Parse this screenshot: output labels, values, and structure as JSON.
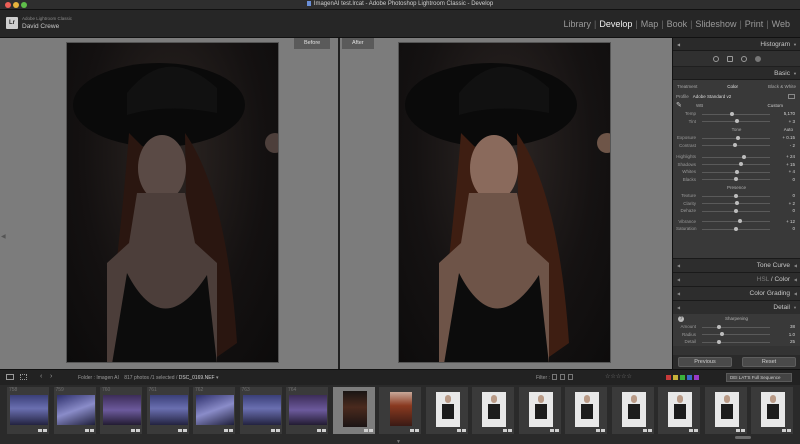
{
  "window": {
    "title": "ImagenAI test.lrcat - Adobe Photoshop Lightroom Classic - Develop"
  },
  "identity": {
    "logo": "Lr",
    "product": "Adobe Lightroom Classic",
    "user": "David Crewe"
  },
  "modules": [
    {
      "label": "Library",
      "active": false
    },
    {
      "label": "Develop",
      "active": true
    },
    {
      "label": "Map",
      "active": false
    },
    {
      "label": "Book",
      "active": false
    },
    {
      "label": "Slideshow",
      "active": false
    },
    {
      "label": "Print",
      "active": false
    },
    {
      "label": "Web",
      "active": false
    }
  ],
  "view": {
    "before_label": "Before",
    "after_label": "After"
  },
  "panel": {
    "histogram": "Histogram",
    "basic": "Basic",
    "treatment": {
      "label": "Treatment",
      "color": "Color",
      "bw": "Black & White"
    },
    "profile": {
      "label": "Profile",
      "value": "Adobe Standard v2"
    },
    "wb": {
      "label": "WB",
      "value": "Custom"
    },
    "temp": {
      "label": "Temp",
      "value": "5,170",
      "level": 0.44
    },
    "tint": {
      "label": "Tint",
      "value": "+ 3",
      "level": 0.52
    },
    "tone_label": "Tone",
    "auto_label": "Auto",
    "exposure": {
      "label": "Exposure",
      "value": "+ 0.15",
      "level": 0.53
    },
    "contrast": {
      "label": "Contrast",
      "value": "- 2",
      "level": 0.49
    },
    "highlights": {
      "label": "Highlights",
      "value": "+ 24",
      "level": 0.62
    },
    "shadows": {
      "label": "Shadows",
      "value": "+ 15",
      "level": 0.57
    },
    "whites": {
      "label": "Whites",
      "value": "+ 4",
      "level": 0.52
    },
    "blacks": {
      "label": "Blacks",
      "value": "0",
      "level": 0.5
    },
    "presence_label": "Presence",
    "texture": {
      "label": "Texture",
      "value": "0",
      "level": 0.5
    },
    "clarity": {
      "label": "Clarity",
      "value": "+ 2",
      "level": 0.51
    },
    "dehaze": {
      "label": "Dehaze",
      "value": "0",
      "level": 0.5
    },
    "vibrance": {
      "label": "Vibrance",
      "value": "+ 12",
      "level": 0.56
    },
    "saturation": {
      "label": "Saturation",
      "value": "0",
      "level": 0.5
    },
    "tone_curve": "Tone Curve",
    "hsl": "HSL",
    "hsl_color": "Color",
    "color_grading": "Color Grading",
    "detail": "Detail",
    "sharpening": "Sharpening",
    "amount": {
      "label": "Amount",
      "value": "38",
      "level": 0.25
    },
    "radius": {
      "label": "Radius",
      "value": "1.0",
      "level": 0.3
    },
    "detail_slider": {
      "label": "Detail",
      "value": "25",
      "level": 0.25
    },
    "previous": "Previous",
    "reset": "Reset"
  },
  "filmstrip_bar": {
    "folder": "Folder : Imagen AI",
    "count": "817 photos /1 selected /",
    "filename": "DSC_0169.NEF",
    "filter_label": "Filter :",
    "filter_value": "DEI LAT'S Full Sequence",
    "chip_colors": [
      "#c73a3a",
      "#c7b23a",
      "#3ab23a",
      "#3a6ac7",
      "#9a3ac7"
    ]
  },
  "filmstrip": [
    {
      "num": "758",
      "thumb": "blue"
    },
    {
      "num": "759",
      "thumb": "blue2"
    },
    {
      "num": "760",
      "thumb": "purple"
    },
    {
      "num": "761",
      "thumb": "blue"
    },
    {
      "num": "762",
      "thumb": "blue2"
    },
    {
      "num": "763",
      "thumb": "blue"
    },
    {
      "num": "764",
      "thumb": "purple"
    },
    {
      "num": "",
      "thumb": "portrait",
      "selected": true
    },
    {
      "num": "",
      "thumb": "red"
    },
    {
      "num": "",
      "thumb": "white"
    },
    {
      "num": "",
      "thumb": "white"
    },
    {
      "num": "",
      "thumb": "white"
    },
    {
      "num": "",
      "thumb": "white"
    },
    {
      "num": "",
      "thumb": "white"
    },
    {
      "num": "",
      "thumb": "white"
    },
    {
      "num": "",
      "thumb": "white"
    },
    {
      "num": "",
      "thumb": "white"
    }
  ]
}
